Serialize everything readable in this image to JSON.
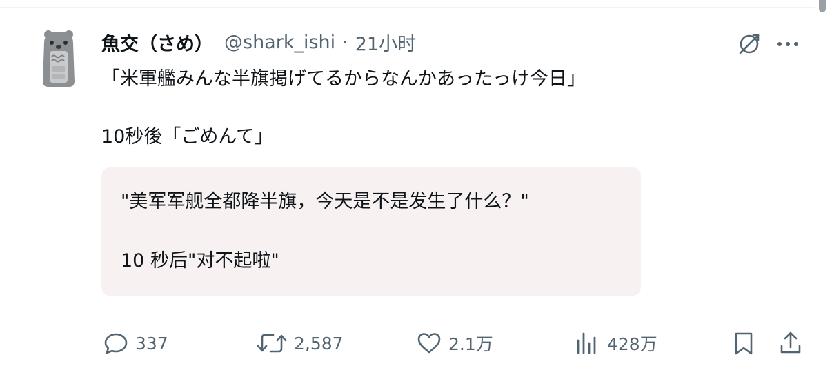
{
  "tweet": {
    "display_name": "魚交（さめ）",
    "handle": "@shark_ishi",
    "separator": "·",
    "time": "21小时",
    "text_line1": "「米軍艦みんな半旗掲げてるからなんかあったっけ今日」",
    "text_line2": "10秒後「ごめんて」"
  },
  "translation": {
    "line1": "\"美军军舰全都降半旗，今天是不是发生了什么？\"",
    "line2": "10 秒后\"对不起啦\""
  },
  "actions": {
    "replies": "337",
    "retweets": "2,587",
    "likes": "2.1万",
    "views": "428万"
  },
  "icons": {
    "translate": "translate-icon",
    "more": "more-icon",
    "reply": "reply-icon",
    "retweet": "retweet-icon",
    "like": "heart-icon",
    "views": "views-icon",
    "bookmark": "bookmark-icon",
    "share": "share-icon"
  },
  "colors": {
    "text": "#0f1419",
    "secondary": "#536471",
    "translation_bg": "#f7f2f1"
  }
}
